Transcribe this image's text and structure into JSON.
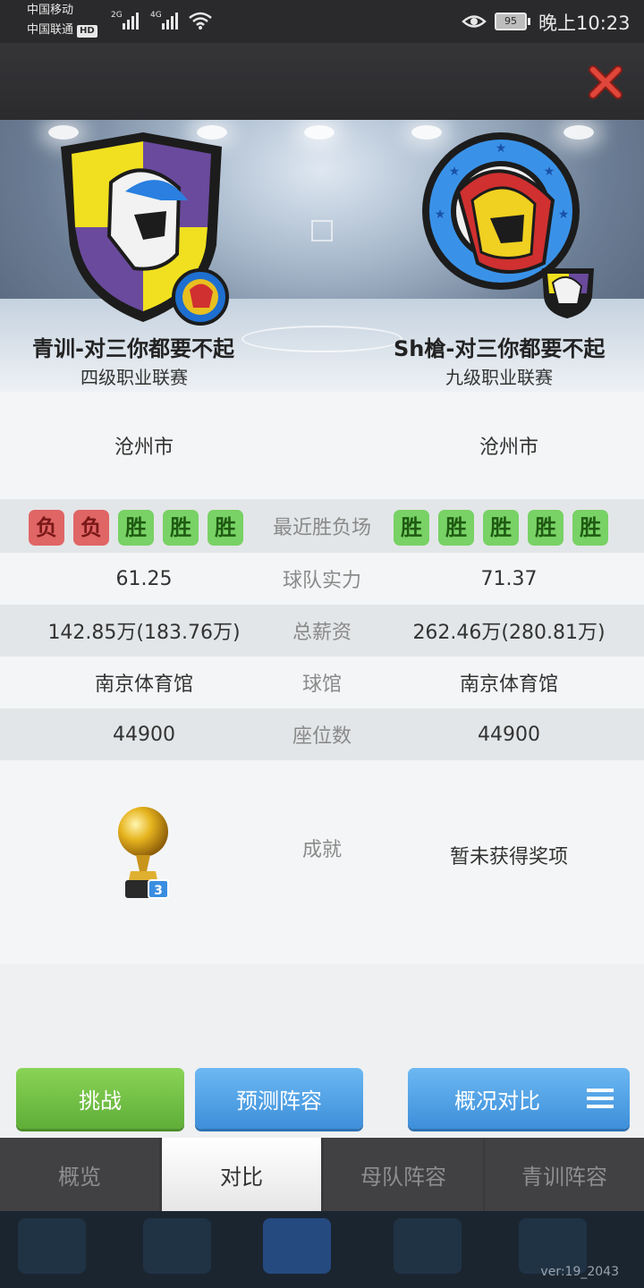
{
  "status_bar": {
    "carrier1": "中国移动",
    "carrier2": "中国联通",
    "hd": "HD",
    "network1": "2G",
    "network2": "4G",
    "battery": "95",
    "time": "晚上10:23"
  },
  "teams": {
    "left": {
      "name": "青训-对三你都要不起",
      "league": "四级职业联赛"
    },
    "right": {
      "name": "Sh槍-对三你都要不起",
      "league": "九级职业联赛"
    }
  },
  "compare": {
    "city": {
      "left": "沧州市",
      "right": "沧州市"
    },
    "recent": {
      "label": "最近胜负场",
      "left": [
        "负",
        "负",
        "胜",
        "胜",
        "胜"
      ],
      "right": [
        "胜",
        "胜",
        "胜",
        "胜",
        "胜"
      ]
    },
    "strength": {
      "label": "球队实力",
      "left": "61.25",
      "right": "71.37"
    },
    "salary": {
      "label": "总薪资",
      "left": "142.85万(183.76万)",
      "right": "262.46万(280.81万)"
    },
    "arena": {
      "label": "球馆",
      "left": "南京体育馆",
      "right": "南京体育馆"
    },
    "seats": {
      "label": "座位数",
      "left": "44900",
      "right": "44900"
    },
    "achievement": {
      "label": "成就",
      "left_trophy_count": "3",
      "right": "暂未获得奖项"
    }
  },
  "actions": {
    "challenge": "挑战",
    "predict": "预测阵容",
    "overview_compare": "概况对比"
  },
  "tabs": [
    "概览",
    "对比",
    "母队阵容",
    "青训阵容"
  ],
  "version": "ver:19_2043",
  "colors": {
    "lose": "#e06565",
    "win": "#78d265",
    "green_button": "#6cbf45",
    "blue_button": "#4a9ce3",
    "close": "#d83a2e"
  }
}
